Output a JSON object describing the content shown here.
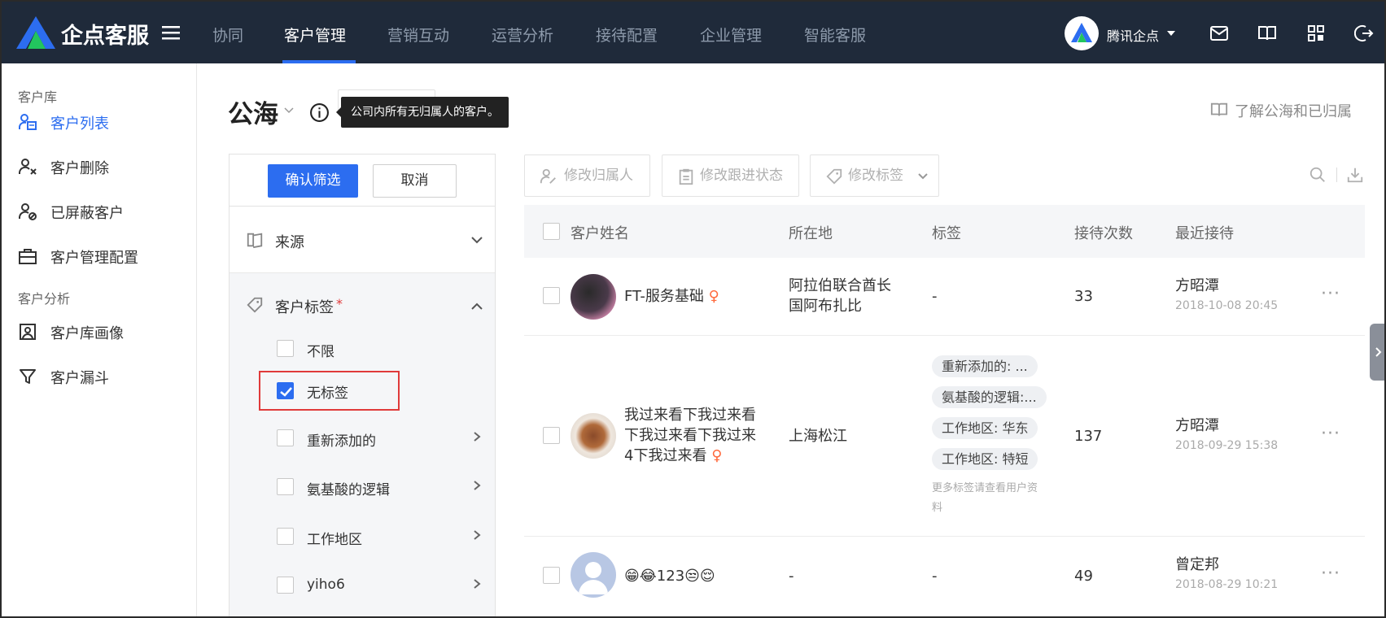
{
  "topbar": {
    "brand": "企点客服",
    "nav": [
      "协同",
      "客户管理",
      "营销互动",
      "运营分析",
      "接待配置",
      "企业管理",
      "智能客服"
    ],
    "active_nav": "客户管理",
    "company": "腾讯企点"
  },
  "sidebar": {
    "group1": "客户库",
    "items1": [
      {
        "label": "客户列表",
        "icon": "contacts-icon",
        "active": true
      },
      {
        "label": "客户删除",
        "icon": "user-remove-icon"
      },
      {
        "label": "已屏蔽客户",
        "icon": "user-block-icon"
      },
      {
        "label": "客户管理配置",
        "icon": "briefcase-icon"
      }
    ],
    "group2": "客户分析",
    "items2": [
      {
        "label": "客户库画像",
        "icon": "portrait-icon"
      },
      {
        "label": "客户漏斗",
        "icon": "funnel-icon"
      }
    ]
  },
  "header": {
    "title": "公海",
    "tooltip": "公司内所有无归属人的客户。",
    "learn_link": "了解公海和已归属"
  },
  "filter": {
    "confirm": "确认筛选",
    "cancel": "取消",
    "source": "来源",
    "tags_title": "客户标签",
    "required_mark": "*",
    "options": [
      {
        "label": "不限",
        "checked": false
      },
      {
        "label": "无标签",
        "checked": true
      },
      {
        "label": "重新添加的",
        "checked": false
      },
      {
        "label": "氨基酸的逻辑",
        "checked": false
      },
      {
        "label": "工作地区",
        "checked": false
      },
      {
        "label": "yiho6",
        "checked": false
      }
    ]
  },
  "toolbar": {
    "change_owner": "修改归属人",
    "change_status": "修改跟进状态",
    "change_tags": "修改标签"
  },
  "table": {
    "headers": [
      "客户姓名",
      "所在地",
      "标签",
      "接待次数",
      "最近接待"
    ],
    "rows": [
      {
        "name": "FT-服务基础",
        "gender": "♀",
        "location1": "阿拉伯联合酋长",
        "location2": "国阿布扎比",
        "tags": "-",
        "count": "33",
        "agent": "方昭潭",
        "time": "2018-10-08 20:45"
      },
      {
        "name1": "我过来看下我过来看",
        "name2": "下我过来看下我过来",
        "name3": "4下我过来看",
        "gender": "♀",
        "location": "上海松江",
        "tag_list": [
          "重新添加的: ...",
          "氨基酸的逻辑:...",
          "工作地区: 华东",
          "工作地区: 特短"
        ],
        "tag_more1": "更多标签请查看用户资",
        "tag_more2": "料",
        "count": "137",
        "agent": "方昭潭",
        "time": "2018-09-29 15:38"
      },
      {
        "name": "😁😂123😒😌",
        "location": "-",
        "tags": "-",
        "count": "49",
        "agent": "曾定邦",
        "time": "2018-08-29 10:21"
      }
    ],
    "more": "···"
  },
  "colors": {
    "accent": "#2c6df0",
    "topbar": "#1f2a3a",
    "highlight_box": "#e03a3a"
  }
}
